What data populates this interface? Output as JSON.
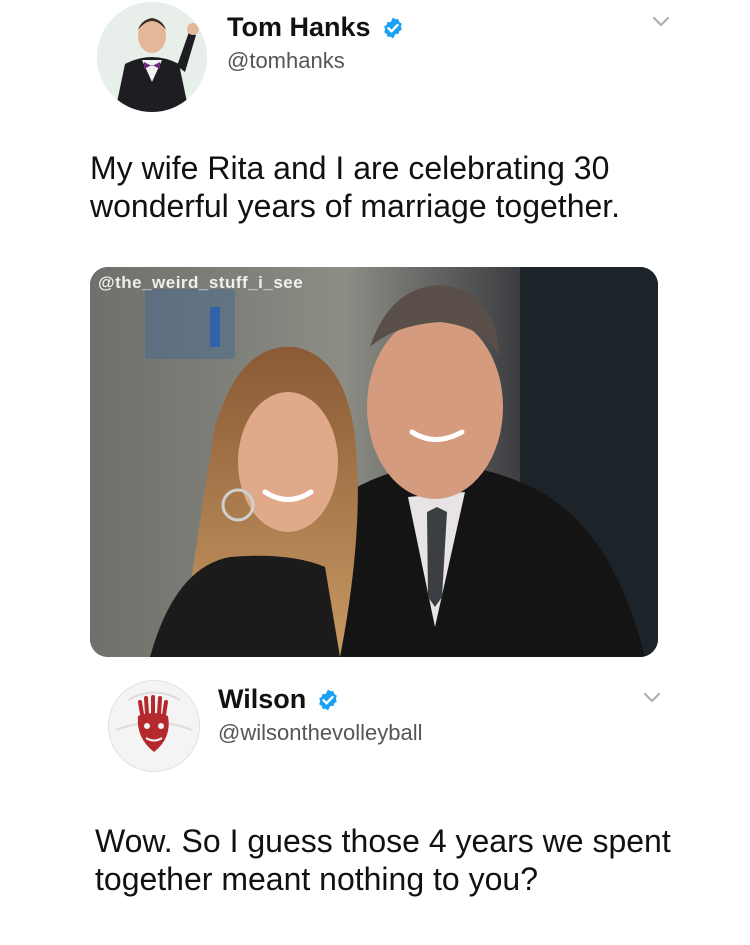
{
  "tweet1": {
    "name": "Tom Hanks",
    "handle": "@tomhanks",
    "text": "My wife Rita and I are celebrating 30 wonderful years of marriage together.",
    "media_watermark": "@the_weird_stuff_i_see",
    "avatar_icon": "profile-photo",
    "verified_icon": "verified-badge-icon",
    "chevron_icon": "chevron-down-icon"
  },
  "tweet2": {
    "name": "Wilson",
    "handle": "@wilsonthevolleyball",
    "text": "Wow. So I guess those 4 years we spent together meant nothing to you?",
    "avatar_icon": "volleyball-avatar",
    "verified_icon": "verified-badge-icon",
    "chevron_icon": "chevron-down-icon"
  },
  "colors": {
    "verified_blue": "#1da1f2",
    "text": "#111111",
    "handle": "#555555",
    "chevron": "#b0b0b0"
  }
}
